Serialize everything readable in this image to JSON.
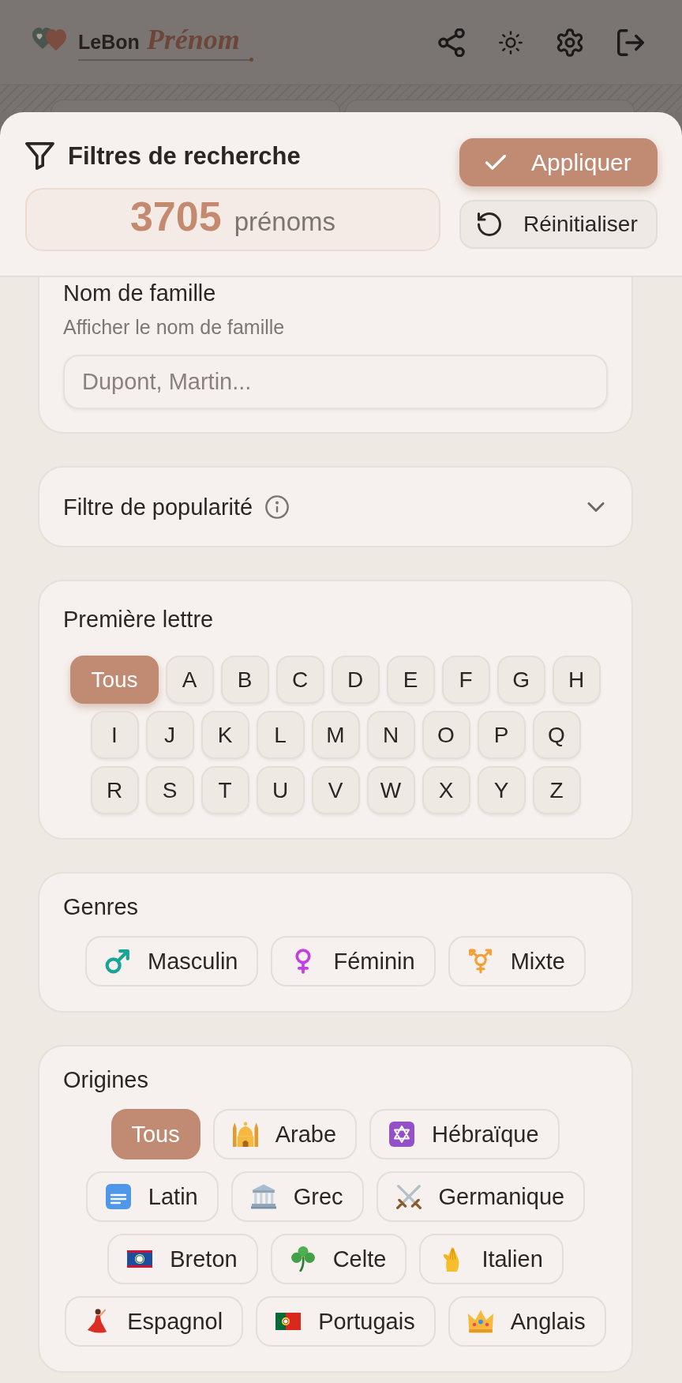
{
  "app_header": {
    "logo_text": "LeBon",
    "logo_accent": "Prénom"
  },
  "filter_sheet": {
    "title": "Filtres de recherche",
    "count": "3705",
    "count_label": "prénoms",
    "buttons": [
      {
        "label": "Appliquer",
        "kind": "primary"
      },
      {
        "label": "Réinitialiser",
        "kind": "secondary"
      }
    ]
  },
  "surname": {
    "title": "Nom de famille",
    "hint": "Afficher le nom de famille",
    "placeholder": "Dupont, Martin..."
  },
  "popularity": {
    "title": "Filtre de popularité",
    "expanded": false
  },
  "first_letter": {
    "title": "Première lettre",
    "options": [
      {
        "label": "Tous",
        "selected": true
      },
      {
        "label": "A",
        "selected": false
      },
      {
        "label": "B",
        "selected": false
      },
      {
        "label": "C",
        "selected": false
      },
      {
        "label": "D",
        "selected": false
      },
      {
        "label": "E",
        "selected": false
      },
      {
        "label": "F",
        "selected": false
      },
      {
        "label": "G",
        "selected": false
      },
      {
        "label": "H",
        "selected": false
      },
      {
        "label": "I",
        "selected": false
      },
      {
        "label": "J",
        "selected": false
      },
      {
        "label": "K",
        "selected": false
      },
      {
        "label": "L",
        "selected": false
      },
      {
        "label": "M",
        "selected": false
      },
      {
        "label": "N",
        "selected": false
      },
      {
        "label": "O",
        "selected": false
      },
      {
        "label": "P",
        "selected": false
      },
      {
        "label": "Q",
        "selected": false
      },
      {
        "label": "R",
        "selected": false
      },
      {
        "label": "S",
        "selected": false
      },
      {
        "label": "T",
        "selected": false
      },
      {
        "label": "U",
        "selected": false
      },
      {
        "label": "V",
        "selected": false
      },
      {
        "label": "W",
        "selected": false
      },
      {
        "label": "X",
        "selected": false
      },
      {
        "label": "Y",
        "selected": false
      },
      {
        "label": "Z",
        "selected": false
      }
    ]
  },
  "genders": {
    "title": "Genres",
    "options": [
      {
        "label": "Masculin",
        "selected": false
      },
      {
        "label": "Féminin",
        "selected": false
      },
      {
        "label": "Mixte",
        "selected": false
      }
    ]
  },
  "origins": {
    "title": "Origines",
    "options": [
      {
        "label": "Tous",
        "selected": true
      },
      {
        "label": "Arabe",
        "selected": false
      },
      {
        "label": "Hébraïque",
        "selected": false
      },
      {
        "label": "Latin",
        "selected": false
      },
      {
        "label": "Grec",
        "selected": false
      },
      {
        "label": "Germanique",
        "selected": false
      },
      {
        "label": "Breton",
        "selected": false
      },
      {
        "label": "Celte",
        "selected": false
      },
      {
        "label": "Italien",
        "selected": false
      },
      {
        "label": "Espagnol",
        "selected": false
      },
      {
        "label": "Portugais",
        "selected": false
      },
      {
        "label": "Anglais",
        "selected": false
      }
    ]
  }
}
